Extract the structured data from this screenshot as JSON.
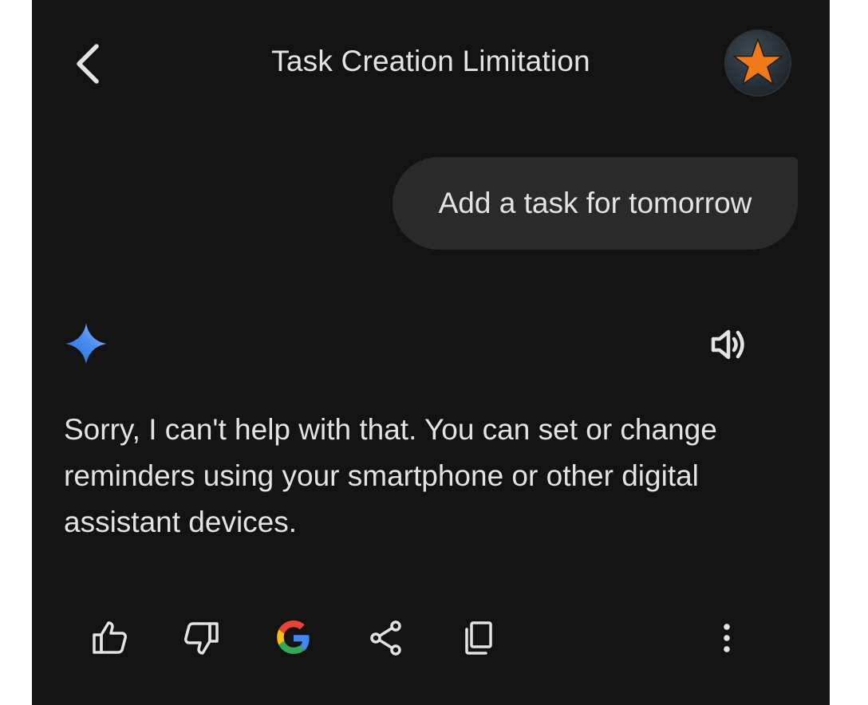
{
  "header": {
    "title": "Task Creation Limitation",
    "back_icon": "chevron-left-icon",
    "avatar": {
      "icon": "star-icon",
      "color": "#f07a1a"
    }
  },
  "conversation": {
    "user_message": "Add a task for tomorrow",
    "assistant": {
      "icon": "gemini-sparkle-icon",
      "listen_icon": "speaker-icon",
      "response_text": "Sorry, I can't help with that. You can set or change reminders using your smartphone or other digital assistant devices."
    }
  },
  "actions": [
    {
      "name": "thumbs-up-icon"
    },
    {
      "name": "thumbs-down-icon"
    },
    {
      "name": "google-g-icon"
    },
    {
      "name": "share-icon"
    },
    {
      "name": "copy-icon"
    },
    {
      "name": "more-vert-icon"
    }
  ],
  "colors": {
    "background": "#131314",
    "bubble": "#2a2a2b",
    "text": "#e3e3e3",
    "accent_star": "#f07a1a"
  }
}
